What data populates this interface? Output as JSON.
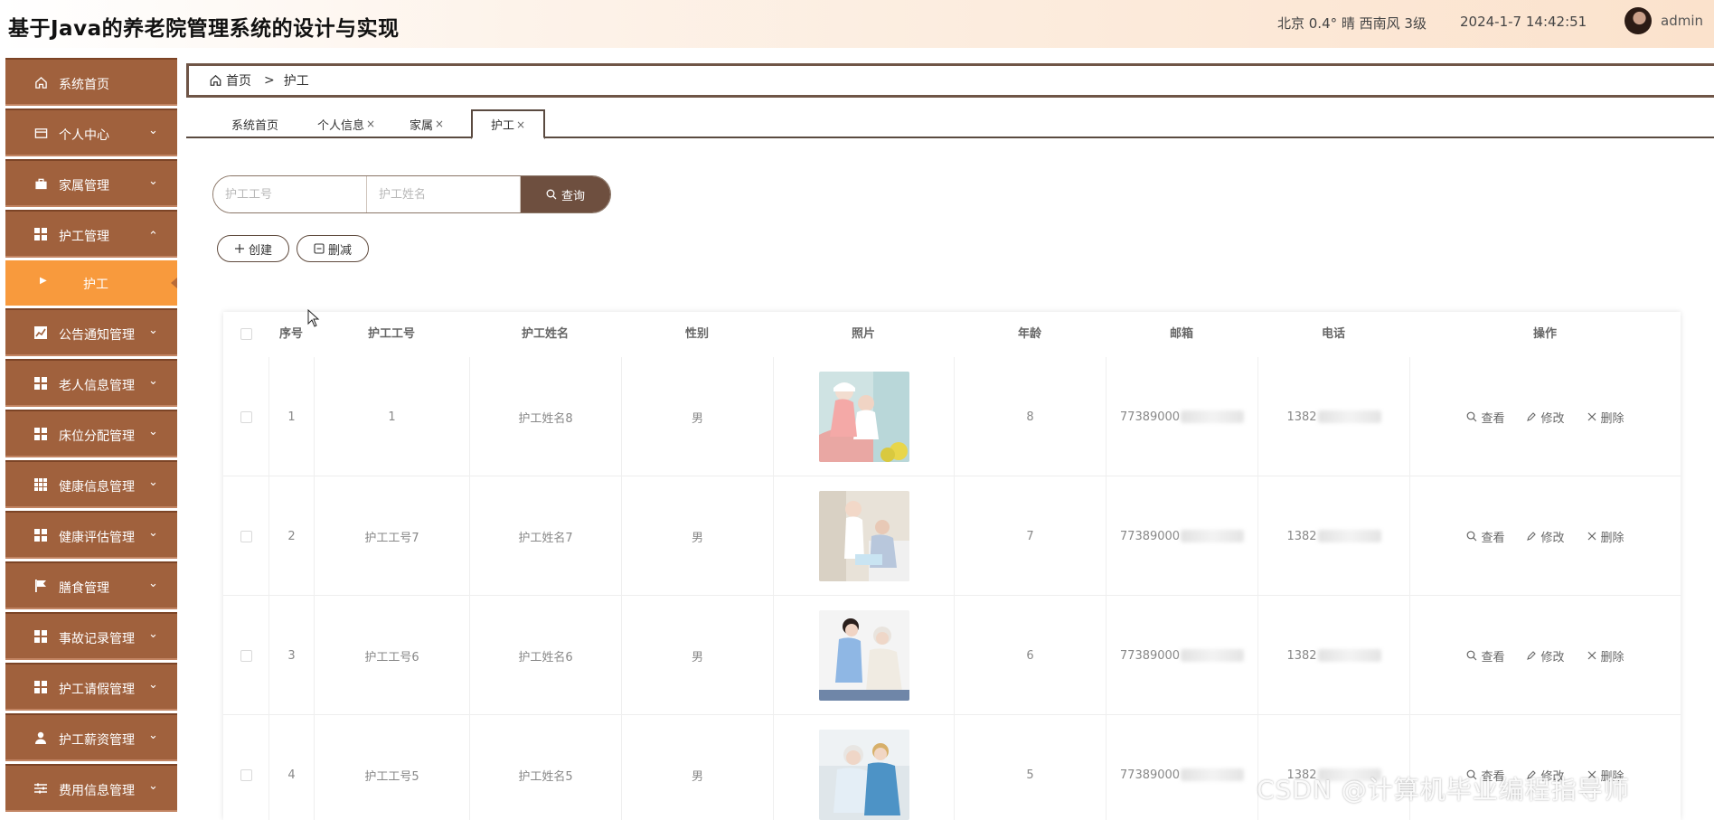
{
  "header": {
    "title": "基于Java的养老院管理系统的设计与实现",
    "weather": "北京  0.4°  晴  西南风  3级",
    "datetime": "2024-1-7 14:42:51",
    "username": "admin"
  },
  "sidebar": {
    "items": [
      {
        "label": "系统首页",
        "icon": "home-icon"
      },
      {
        "label": "个人中心",
        "icon": "card-icon"
      },
      {
        "label": "家属管理",
        "icon": "briefcase-icon"
      },
      {
        "label": "护工管理",
        "icon": "grid-icon"
      },
      {
        "label": "公告通知管理",
        "icon": "chart-icon"
      },
      {
        "label": "老人信息管理",
        "icon": "grid-icon"
      },
      {
        "label": "床位分配管理",
        "icon": "grid-icon"
      },
      {
        "label": "健康信息管理",
        "icon": "table-icon"
      },
      {
        "label": "健康评估管理",
        "icon": "grid-icon"
      },
      {
        "label": "膳食管理",
        "icon": "flag-icon"
      },
      {
        "label": "事故记录管理",
        "icon": "grid-icon"
      },
      {
        "label": "护工请假管理",
        "icon": "grid-icon"
      },
      {
        "label": "护工薪资管理",
        "icon": "user-icon"
      },
      {
        "label": "费用信息管理",
        "icon": "sliders-icon"
      }
    ],
    "sub_item": "护工"
  },
  "breadcrumb": {
    "home": "首页",
    "sep": ">",
    "current": "护工"
  },
  "tabs": [
    {
      "label": "系统首页",
      "closable": ""
    },
    {
      "label": "个人信息",
      "closable": "×"
    },
    {
      "label": "家属",
      "closable": "×"
    },
    {
      "label": "护工",
      "closable": "×"
    }
  ],
  "search": {
    "field1_placeholder": "护工工号",
    "field2_placeholder": "护工姓名",
    "button": "查询"
  },
  "actions": {
    "create": "创建",
    "delete": "删减"
  },
  "table": {
    "columns": [
      "序号",
      "护工工号",
      "护工姓名",
      "性别",
      "照片",
      "年龄",
      "邮箱",
      "电话",
      "操作"
    ],
    "rows": [
      {
        "index": "1",
        "code": "1",
        "name": "护工姓名8",
        "gender": "男",
        "age": "8",
        "email": "77389000",
        "phone": "1382"
      },
      {
        "index": "2",
        "code": "护工工号7",
        "name": "护工姓名7",
        "gender": "男",
        "age": "7",
        "email": "77389000",
        "phone": "1382"
      },
      {
        "index": "3",
        "code": "护工工号6",
        "name": "护工姓名6",
        "gender": "男",
        "age": "6",
        "email": "77389000",
        "phone": "1382"
      },
      {
        "index": "4",
        "code": "护工工号5",
        "name": "护工姓名5",
        "gender": "男",
        "age": "5",
        "email": "77389000",
        "phone": "1382"
      }
    ],
    "ops": {
      "view": "查看",
      "edit": "修改",
      "remove": "删除"
    }
  },
  "watermark": "CSDN @计算机毕业编程指导师",
  "colors": {
    "sidebar": "#a0613d",
    "sidebar_active": "#f89a3d",
    "search_button": "#6e4f3f"
  }
}
